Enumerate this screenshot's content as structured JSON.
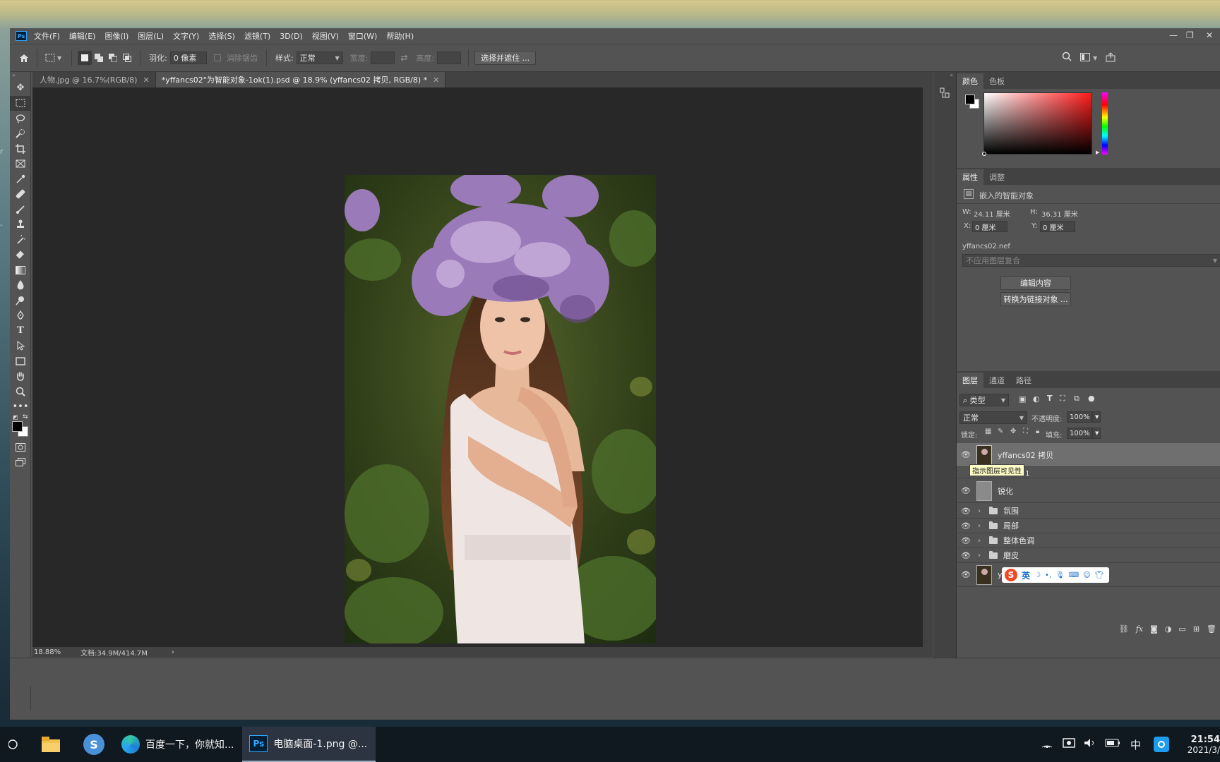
{
  "menubar": {
    "items": [
      "文件(F)",
      "编辑(E)",
      "图像(I)",
      "图层(L)",
      "文字(Y)",
      "选择(S)",
      "滤镜(T)",
      "3D(D)",
      "视图(V)",
      "窗口(W)",
      "帮助(H)"
    ]
  },
  "options": {
    "feather_label": "羽化:",
    "feather_value": "0 像素",
    "antialias_label": "消除锯齿",
    "style_label": "样式:",
    "style_value": "正常",
    "width_label": "宽度:",
    "height_label": "高度:",
    "select_mask_button": "选择并遮住 ..."
  },
  "tabs": [
    {
      "label": "人物.jpg @ 16.7%(RGB/8)"
    },
    {
      "label": "*yffancs02\"为智能对象-1ok(1).psd @ 18.9% (yffancs02 拷贝, RGB/8) *"
    }
  ],
  "status": {
    "zoom": "18.88%",
    "doc": "文档:34.9M/414.7M"
  },
  "color_panel": {
    "tab_color": "颜色",
    "tab_swatches": "色板",
    "gradient_hue": "#ff1a1a"
  },
  "properties": {
    "tab_properties": "属性",
    "tab_adjust": "调整",
    "kind": "嵌入的智能对象",
    "w_label": "W:",
    "w_value": "24.11 厘米",
    "h_label": "H:",
    "h_value": "36.31 厘米",
    "x_label": "X:",
    "x_value": "0 厘米",
    "y_label": "Y:",
    "y_value": "0 厘米",
    "file_name": "yffancs02.nef",
    "layer_comp": "不应用图层复合",
    "edit_button": "编辑内容",
    "convert_button": "转换为链接对象 ..."
  },
  "layers_panel": {
    "tab_layers": "图层",
    "tab_channels": "通道",
    "tab_paths": "路径",
    "filter_kind": "类型",
    "blend_mode": "正常",
    "opacity_label": "不透明度:",
    "opacity_value": "100%",
    "lock_label": "锁定:",
    "fill_label": "填充:",
    "fill_value": "100%",
    "tooltip": "指示图层可见性",
    "layers": [
      {
        "name": "yffancs02 拷贝"
      },
      {
        "name": "组 1"
      },
      {
        "name": "锐化"
      },
      {
        "name": "氛围"
      },
      {
        "name": "局部"
      },
      {
        "name": "整体色调"
      },
      {
        "name": "磨皮"
      },
      {
        "name": "yff"
      }
    ]
  },
  "ime": {
    "lang": "英"
  },
  "taskbar": {
    "browser_label": "百度一下，你就知...",
    "ps_label": "电脑桌面-1.png @...",
    "ime_indicator": "中",
    "time": "21:54",
    "date": "2021/3/"
  }
}
